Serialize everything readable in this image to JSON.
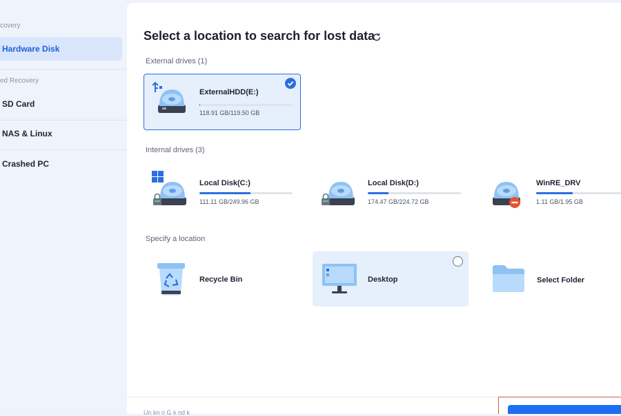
{
  "sidebar": {
    "groups": [
      "covery",
      "ed Recovery"
    ],
    "items": [
      {
        "label": "Hardware Disk",
        "active": true
      },
      {
        "label": "SD Card"
      },
      {
        "label": "NAS & Linux"
      },
      {
        "label": "Crashed PC"
      }
    ]
  },
  "main": {
    "title": "Select a location to search for lost data",
    "external_label": "External drives (1)",
    "internal_label": "Internal drives (3)",
    "specify_label": "Specify a location",
    "external_drives": [
      {
        "name": "ExternalHDD(E:)",
        "size": "118.91 GB/119.50 GB",
        "usage": 0.005,
        "selected": true
      }
    ],
    "internal_drives": [
      {
        "name": "Local Disk(C:)",
        "size": "111.11 GB/249.96 GB",
        "usage": 0.55
      },
      {
        "name": "Local Disk(D:)",
        "size": "174.47 GB/224.72 GB",
        "usage": 0.22
      },
      {
        "name": "WinRE_DRV",
        "size": "1.11 GB/1.95 GB",
        "usage": 0.43
      }
    ],
    "locations": [
      {
        "name": "Recycle Bin"
      },
      {
        "name": "Desktop"
      },
      {
        "name": "Select Folder"
      }
    ]
  },
  "footer": {
    "text": "Un kn o  G  k  nd  k    "
  },
  "colors": {
    "accent": "#2a6fe0",
    "selected_bg": "#e6effc",
    "scan_button": "#1d6ef0"
  }
}
